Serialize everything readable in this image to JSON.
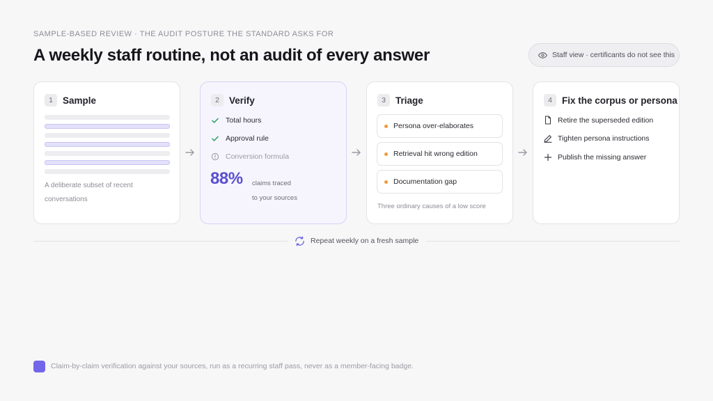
{
  "header": {
    "eyebrow": "SAMPLE-BASED REVIEW · THE AUDIT POSTURE THE STANDARD ASKS FOR",
    "title": "A weekly staff routine, not an audit of every answer",
    "staff_pill": "Staff view · certificants do not see this"
  },
  "steps": [
    {
      "num": "1",
      "title": "Sample",
      "caption_lines": [
        "A deliberate subset of recent",
        "conversations"
      ]
    },
    {
      "num": "2",
      "title": "Verify",
      "checks": [
        {
          "label": "Total hours",
          "state": "done"
        },
        {
          "label": "Approval rule",
          "state": "done"
        },
        {
          "label": "Conversion formula",
          "state": "pending"
        }
      ],
      "stat_value": "88%",
      "stat_label_lines": [
        "claims traced",
        "to your sources"
      ]
    },
    {
      "num": "3",
      "title": "Triage",
      "causes": [
        "Persona over-elaborates",
        "Retrieval hit wrong edition",
        "Documentation gap"
      ],
      "caption": "Three ordinary causes of a low score"
    },
    {
      "num": "4",
      "title": "Fix the corpus or persona",
      "actions": [
        {
          "label": "Retire the superseded edition",
          "icon": "document-icon"
        },
        {
          "label": "Tighten persona instructions",
          "icon": "pencil-icon"
        },
        {
          "label": "Publish the missing answer",
          "icon": "plus-icon"
        }
      ]
    }
  ],
  "repeat_label": "Repeat weekly on a fresh sample",
  "legend": {
    "text": "Claim-by-claim verification against your sources, run as a recurring staff pass, never as a member-facing badge.",
    "color": "#7466ea"
  },
  "colors": {
    "accent": "#5a4fcf",
    "check": "#3aa46a",
    "cause_dot": "#f2993a"
  }
}
